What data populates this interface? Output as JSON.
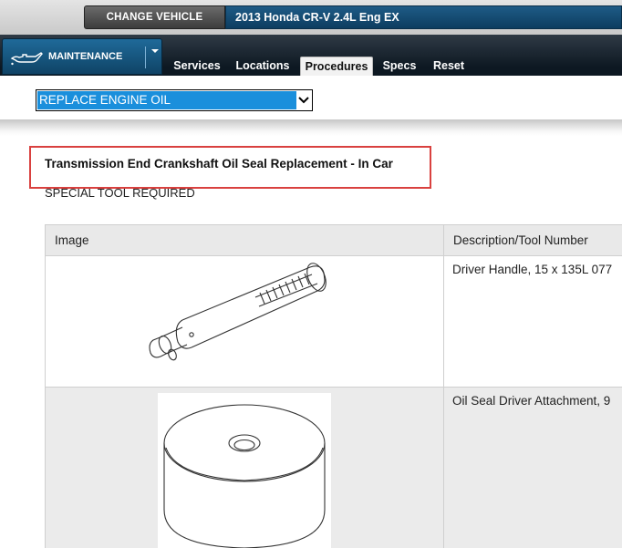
{
  "header": {
    "change_vehicle_label": "CHANGE VEHICLE",
    "vehicle": "2013 Honda CR-V 2.4L Eng EX"
  },
  "nav": {
    "module_label": "MAINTENANCE",
    "module_icon": "oil-can-icon",
    "tabs": [
      {
        "label": "Services",
        "active": false
      },
      {
        "label": "Locations",
        "active": false
      },
      {
        "label": "Procedures",
        "active": true
      },
      {
        "label": "Specs",
        "active": false
      },
      {
        "label": "Reset",
        "active": false
      }
    ]
  },
  "procedure_select": {
    "value": "REPLACE ENGINE OIL"
  },
  "content": {
    "title": "Transmission End Crankshaft Oil Seal Replacement - In Car",
    "subtitle": "SPECIAL TOOL REQUIRED",
    "table": {
      "headers": [
        "Image",
        "Description/Tool Number"
      ],
      "rows": [
        {
          "image": "driver-handle-drawing",
          "description": "Driver Handle, 15 x 135L 077"
        },
        {
          "image": "oil-seal-driver-attachment-drawing",
          "description": "Oil Seal Driver Attachment, 9"
        }
      ]
    }
  },
  "colors": {
    "vehicle_bar": "#0d3d60",
    "tab_bar": "#0d1822",
    "module_menu": "#1f6a99",
    "select_highlight": "#1a8fdc",
    "highlight_box": "#d9413f"
  }
}
